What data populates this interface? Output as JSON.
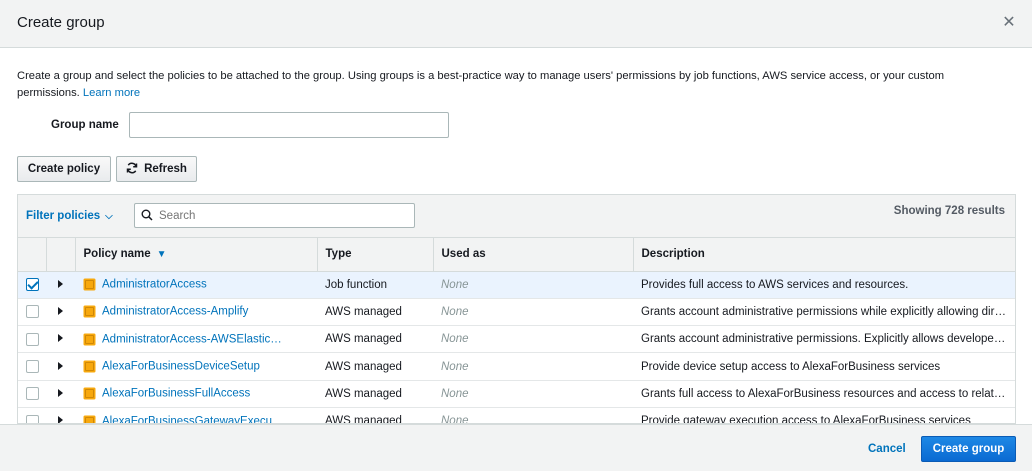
{
  "modal": {
    "title": "Create group",
    "close_glyph": "✕",
    "close_icon": "close-icon"
  },
  "intro": {
    "text": "Create a group and select the policies to be attached to the group. Using groups is a best-practice way to manage users' permissions by job functions, AWS service access, or your custom permissions.",
    "link": "Learn more"
  },
  "group_name": {
    "label": "Group name",
    "value": "",
    "placeholder": ""
  },
  "buttons": {
    "create_policy": "Create policy",
    "refresh": "Refresh",
    "refresh_icon": "refresh-icon"
  },
  "toolbar": {
    "filter_label": "Filter policies",
    "search_placeholder": "Search",
    "result_count": "Showing 728 results"
  },
  "table": {
    "columns": [
      "",
      "",
      "Policy name",
      "Type",
      "Used as",
      "Description"
    ],
    "sorted_column": "Policy name",
    "sort_direction": "descending",
    "rows": [
      {
        "checked": true,
        "name": "AdministratorAccess",
        "type": "Job function",
        "used_as": "None",
        "description": "Provides full access to AWS services and resources."
      },
      {
        "checked": false,
        "name": "AdministratorAccess-Amplify",
        "type": "AWS managed",
        "used_as": "None",
        "description": "Grants account administrative permissions while explicitly allowing direct ac…"
      },
      {
        "checked": false,
        "name": "AdministratorAccess-AWSElastic…",
        "type": "AWS managed",
        "used_as": "None",
        "description": "Grants account administrative permissions. Explicitly allows developers and …"
      },
      {
        "checked": false,
        "name": "AlexaForBusinessDeviceSetup",
        "type": "AWS managed",
        "used_as": "None",
        "description": "Provide device setup access to AlexaForBusiness services"
      },
      {
        "checked": false,
        "name": "AlexaForBusinessFullAccess",
        "type": "AWS managed",
        "used_as": "None",
        "description": "Grants full access to AlexaForBusiness resources and access to related AW…"
      },
      {
        "checked": false,
        "name": "AlexaForBusinessGatewayExecu…",
        "type": "AWS managed",
        "used_as": "None",
        "description": "Provide gateway execution access to AlexaForBusiness services"
      }
    ]
  },
  "footer": {
    "cancel": "Cancel",
    "create_group": "Create group"
  },
  "colors": {
    "link": "#0073bb",
    "primary": "#0972d3",
    "header_bg": "#f2f3f3",
    "selected_row": "#eaf3fe",
    "policy_icon": "#f7a80d"
  }
}
